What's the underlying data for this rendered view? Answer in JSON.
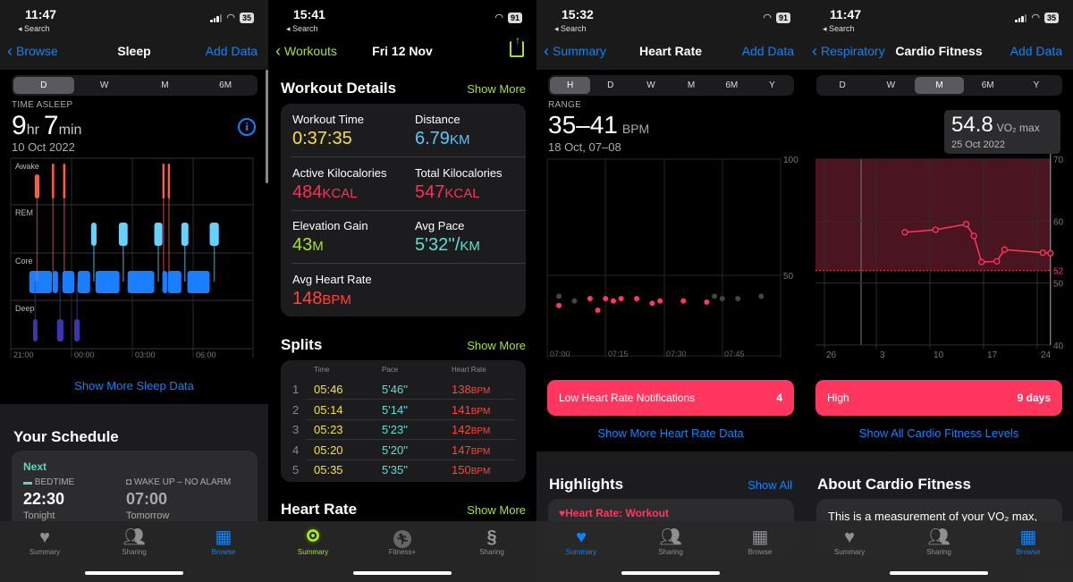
{
  "sleep_panel": {
    "status": {
      "time": "11:47",
      "back": "◂ Search",
      "battery": "35"
    },
    "nav": {
      "back": "Browse",
      "title": "Sleep",
      "right": "Add Data"
    },
    "segments": [
      "D",
      "W",
      "M",
      "6M"
    ],
    "selected_segment": "D",
    "metric_label": "TIME ASLEEP",
    "hours": "9",
    "hours_unit": "hr",
    "minutes": "7",
    "minutes_unit": "min",
    "date": "10 Oct 2022",
    "show_more": "Show More Sleep Data",
    "schedule": {
      "title": "Your Schedule",
      "next": "Next",
      "bedtime_label": "BEDTIME",
      "bedtime": "22:30",
      "bedtime_day": "Tonight",
      "wake_label": "WAKE UP – NO ALARM",
      "wake": "07:00",
      "wake_day": "Tomorrow"
    },
    "tabs": [
      {
        "label": "Summary",
        "icon": "heart-icon"
      },
      {
        "label": "Sharing",
        "icon": "people-icon"
      },
      {
        "label": "Browse",
        "icon": "grid-icon",
        "active": true
      }
    ]
  },
  "workout_panel": {
    "status": {
      "time": "15:41",
      "back": "◂ Search",
      "battery": "91"
    },
    "nav": {
      "back": "Workouts",
      "title": "Fri 12 Nov",
      "right_icon": "share-icon"
    },
    "details_title": "Workout Details",
    "show_more": "Show More",
    "details": [
      {
        "label": "Workout Time",
        "value": "0:37:35",
        "unit": "",
        "color": "#f4e23a"
      },
      {
        "label": "Distance",
        "value": "6.79",
        "unit": "KM",
        "color": "#5ac8fa"
      },
      {
        "label": "Active Kilocalories",
        "value": "484",
        "unit": "KCAL",
        "color": "#ff2d55"
      },
      {
        "label": "Total Kilocalories",
        "value": "547",
        "unit": "KCAL",
        "color": "#ff2d55"
      },
      {
        "label": "Elevation Gain",
        "value": "43",
        "unit": "M",
        "color": "#a6e22e"
      },
      {
        "label": "Avg Pace",
        "value": "5'32''/",
        "unit": "KM",
        "color": "#5ae0d2"
      },
      {
        "label": "Avg Heart Rate",
        "value": "148",
        "unit": "BPM",
        "color": "#ff453a"
      }
    ],
    "splits_title": "Splits",
    "splits_headers": [
      "Time",
      "Pace",
      "Heart Rate"
    ],
    "splits": [
      {
        "n": "1",
        "time": "05:46",
        "pace": "5'46''",
        "hr": "138",
        "unit": "BPM"
      },
      {
        "n": "2",
        "time": "05:14",
        "pace": "5'14''",
        "hr": "141",
        "unit": "BPM"
      },
      {
        "n": "3",
        "time": "05:23",
        "pace": "5'23''",
        "hr": "142",
        "unit": "BPM"
      },
      {
        "n": "4",
        "time": "05:20",
        "pace": "5'20''",
        "hr": "147",
        "unit": "BPM"
      },
      {
        "n": "5",
        "time": "05:35",
        "pace": "5'35''",
        "hr": "150",
        "unit": "BPM"
      }
    ],
    "hr_title": "Heart Rate",
    "tabs": [
      {
        "label": "Summary",
        "active": true
      },
      {
        "label": "Fitness+"
      },
      {
        "label": "Sharing"
      }
    ]
  },
  "heart_panel": {
    "status": {
      "time": "15:32",
      "back": "◂ Search",
      "battery": "91"
    },
    "nav": {
      "back": "Summary",
      "title": "Heart Rate",
      "right": "Add Data"
    },
    "segments": [
      "H",
      "D",
      "W",
      "M",
      "6M",
      "Y"
    ],
    "selected_segment": "H",
    "metric_label": "RANGE",
    "value": "35–41",
    "unit": "BPM",
    "date": "18 Oct, 07–08",
    "notif_label": "Low Heart Rate Notifications",
    "notif_count": "4",
    "show_more": "Show More Heart Rate Data",
    "highlights_title": "Highlights",
    "show_all": "Show All",
    "highlight_item": "Heart Rate: Workout",
    "tabs": [
      {
        "label": "Summary",
        "active": true
      },
      {
        "label": "Sharing"
      },
      {
        "label": "Browse"
      }
    ]
  },
  "cardio_panel": {
    "status": {
      "time": "11:47",
      "back": "◂ Search",
      "battery": "35"
    },
    "nav": {
      "back": "Respiratory",
      "title": "Cardio Fitness",
      "right": "Add Data"
    },
    "segments": [
      "D",
      "W",
      "M",
      "6M",
      "Y"
    ],
    "selected_segment": "M",
    "tooltip_value": "54.8",
    "tooltip_unit": "VO₂ max",
    "tooltip_date": "25 Oct 2022",
    "level_label": "High",
    "level_days": "9 days",
    "show_all": "Show All Cardio Fitness Levels",
    "about_title": "About Cardio Fitness",
    "about_text": "This is a measurement of your VO₂ max,",
    "tabs": [
      {
        "label": "Summary"
      },
      {
        "label": "Sharing"
      },
      {
        "label": "Browse",
        "active": true
      }
    ]
  },
  "colors": {
    "accent_blue": "#0a84ff",
    "workout_green": "#a6e22e",
    "heart_pink": "#ff375f",
    "awake": "#ff5a45",
    "rem": "#64d2ff",
    "core": "#1a7fff",
    "deep": "#3b36b0"
  },
  "chart_data": [
    {
      "type": "timeline",
      "rows": [
        "Awake",
        "REM",
        "Core",
        "Deep"
      ],
      "x_ticks": [
        "21:00",
        "00:00",
        "03:00",
        "06:00"
      ],
      "segments": [
        {
          "stage": "Core",
          "start": "21:55",
          "end": "23:02"
        },
        {
          "stage": "Deep",
          "start": "22:06",
          "end": "22:19"
        },
        {
          "stage": "Awake",
          "start": "22:11",
          "end": "22:25"
        },
        {
          "stage": "Awake",
          "start": "23:02",
          "end": "23:04"
        },
        {
          "stage": "Core",
          "start": "23:04",
          "end": "23:20"
        },
        {
          "stage": "Deep",
          "start": "23:17",
          "end": "23:36"
        },
        {
          "stage": "Awake",
          "start": "23:35",
          "end": "23:37"
        },
        {
          "stage": "Core",
          "start": "23:33",
          "end": "00:08"
        },
        {
          "stage": "Deep",
          "start": "00:08",
          "end": "00:24"
        },
        {
          "stage": "Core",
          "start": "00:18",
          "end": "00:55"
        },
        {
          "stage": "REM",
          "start": "00:58",
          "end": "01:14"
        },
        {
          "stage": "Core",
          "start": "01:11",
          "end": "02:22"
        },
        {
          "stage": "REM",
          "start": "02:20",
          "end": "02:46"
        },
        {
          "stage": "Core",
          "start": "02:46",
          "end": "04:05"
        },
        {
          "stage": "REM",
          "start": "04:05",
          "end": "04:29"
        },
        {
          "stage": "Awake",
          "start": "04:29",
          "end": "04:31"
        },
        {
          "stage": "Core",
          "start": "04:29",
          "end": "04:43"
        },
        {
          "stage": "Awake",
          "start": "04:45",
          "end": "04:47"
        },
        {
          "stage": "Core",
          "start": "04:45",
          "end": "05:25"
        },
        {
          "stage": "REM",
          "start": "05:25",
          "end": "05:46"
        },
        {
          "stage": "Core",
          "start": "05:43",
          "end": "06:49"
        },
        {
          "stage": "REM",
          "start": "06:49",
          "end": "07:16"
        }
      ]
    },
    {
      "type": "scatter",
      "x_ticks": [
        "07:00",
        "07:15",
        "07:30",
        "07:45"
      ],
      "y_ticks": [
        100,
        50
      ],
      "ylim": [
        15,
        100
      ],
      "points": [
        {
          "time": "07:03",
          "bpm": 41,
          "highlight": false
        },
        {
          "time": "07:03",
          "bpm": 37,
          "highlight": true
        },
        {
          "time": "07:07",
          "bpm": 39,
          "highlight": false
        },
        {
          "time": "07:11",
          "bpm": 40,
          "highlight": true
        },
        {
          "time": "07:13",
          "bpm": 35,
          "highlight": true
        },
        {
          "time": "07:15",
          "bpm": 40,
          "highlight": true
        },
        {
          "time": "07:17",
          "bpm": 39,
          "highlight": true
        },
        {
          "time": "07:19",
          "bpm": 40,
          "highlight": true
        },
        {
          "time": "07:23",
          "bpm": 40,
          "highlight": true
        },
        {
          "time": "07:27",
          "bpm": 38,
          "highlight": true
        },
        {
          "time": "07:29",
          "bpm": 39,
          "highlight": true
        },
        {
          "time": "07:35",
          "bpm": 39,
          "highlight": true
        },
        {
          "time": "07:41",
          "bpm": 38.5,
          "highlight": true
        },
        {
          "time": "07:43",
          "bpm": 41,
          "highlight": false
        },
        {
          "time": "07:45",
          "bpm": 40,
          "highlight": false
        },
        {
          "time": "07:49",
          "bpm": 40,
          "highlight": false
        },
        {
          "time": "07:55",
          "bpm": 41,
          "highlight": false
        }
      ]
    },
    {
      "type": "line",
      "x_ticks": [
        "26",
        "3",
        "10",
        "17",
        "24"
      ],
      "y_ticks": [
        70,
        60,
        50,
        40
      ],
      "ylim": [
        40,
        70
      ],
      "band": {
        "from": 52,
        "to": 70,
        "label": "52"
      },
      "points": [
        {
          "date": "Oct 6",
          "value": 58.2
        },
        {
          "date": "Oct 10",
          "value": 58.6
        },
        {
          "date": "Oct 14",
          "value": 59.5
        },
        {
          "date": "Oct 15",
          "value": 57.6
        },
        {
          "date": "Oct 16",
          "value": 53.4
        },
        {
          "date": "Oct 18",
          "value": 53.5
        },
        {
          "date": "Oct 19",
          "value": 55.4
        },
        {
          "date": "Oct 24",
          "value": 54.9
        },
        {
          "date": "Oct 25",
          "value": 54.8
        }
      ]
    }
  ]
}
